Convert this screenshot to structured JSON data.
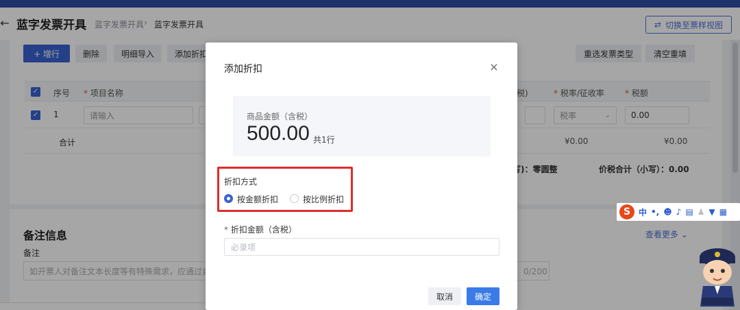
{
  "header": {
    "back_icon": "arrow-left-icon",
    "title": "蓝字发票开具",
    "breadcrumb": [
      "蓝字发票开具",
      "蓝字发票开具"
    ],
    "breadcrumb_sep": "›",
    "switch_view": "切换至票样视图"
  },
  "toolbar": {
    "add_row": "+ 增行",
    "delete": "删除",
    "import_detail": "明细导入",
    "add_discount": "添加折扣",
    "reselect_type": "重选发票类型",
    "clear_refill": "清空重填"
  },
  "table": {
    "headers": {
      "index": "序号",
      "item_name": "项目名称",
      "tax_included": "税)",
      "tax_rate": "税率/征收率",
      "tax_amount": "税额"
    },
    "row": {
      "index": "1",
      "item_placeholder": "请输入",
      "tax_rate_placeholder": "税率",
      "tax_amount": "0.00"
    },
    "sum": {
      "label": "合计",
      "amount": "¥0.00",
      "tax": "¥0.00"
    },
    "total_text": "写)：零圆整",
    "total_label": "价税合计（小写）：0.00"
  },
  "remarks": {
    "title": "备注信息",
    "label": "备注",
    "placeholder": "如开票人对备注文本长度等有特殊需求，应通过自定",
    "count": "0/200",
    "see_more": "查看更多"
  },
  "modal": {
    "title": "添加折扣",
    "close_icon": "close-icon",
    "amount_label": "商品金额（含税）",
    "amount_value": "500.00",
    "rows_text": "共1行",
    "method_label": "折扣方式",
    "options": [
      "按金额折扣",
      "按比例折扣"
    ],
    "selected_option": "按金额折扣",
    "field_label": "折扣金额（含税）",
    "field_required_mark": "*",
    "field_placeholder": "必录项",
    "cancel": "取消",
    "confirm": "确定"
  },
  "ime": {
    "logo": "S",
    "lang": "中"
  },
  "colors": {
    "primary": "#3a63d3",
    "topbar": "#2d4ea3",
    "highlight": "#e02b2b",
    "confirm": "#3a7be8"
  }
}
